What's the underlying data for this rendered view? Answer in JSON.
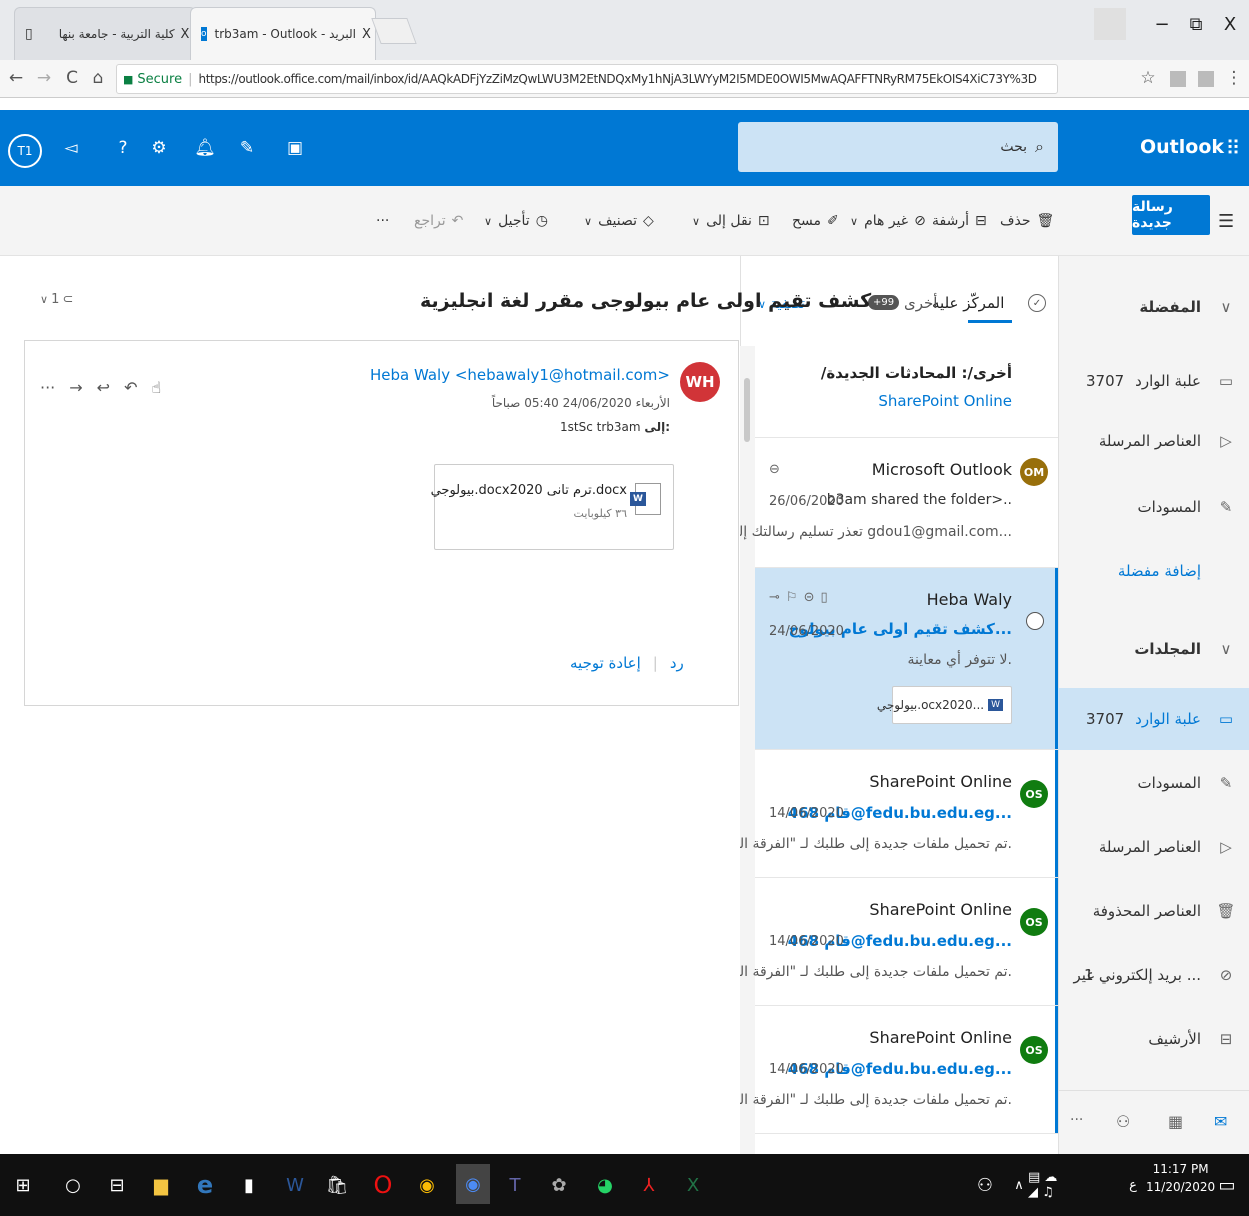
{
  "browser": {
    "tabs": [
      {
        "title": "كلية التربية - جامعة بنها"
      },
      {
        "title": "trb3am - Outlook - البريد"
      }
    ],
    "secure_label": "Secure",
    "url": "https://outlook.office.com/mail/inbox/id/AAQkADFjYzZiMzQwLWU3M2EtNDQxMy1hNjA3LWYyM2I5MDE0OWI5MwAQAFFTNRyRM75EkOIS4XiC73Y%3D"
  },
  "header": {
    "app_name": "Outlook",
    "avatar_initials": "T1",
    "search_placeholder": "بحث"
  },
  "toolbar": {
    "new_message": "رسالة جديدة",
    "delete": "حذف",
    "archive": "أرشفة",
    "junk": "غير هام",
    "sweep": "مسح",
    "move_to": "نقل إلى",
    "categorize": "تصنيف",
    "snooze": "تأجيل",
    "undo": "تراجع",
    "more": "···"
  },
  "nav": {
    "favorites_header": "المفضلة",
    "favorites": [
      {
        "label": "علبة الوارد",
        "count": "3707"
      },
      {
        "label": "العناصر المرسلة",
        "count": ""
      },
      {
        "label": "المسودات",
        "count": ""
      }
    ],
    "add_favorite": "إضافة مفضلة",
    "folders_header": "المجلدات",
    "folders": [
      {
        "label": "علبة الوارد",
        "count": "3707"
      },
      {
        "label": "المسودات",
        "count": ""
      },
      {
        "label": "العناصر المرسلة",
        "count": ""
      },
      {
        "label": "العناصر المحذوفة",
        "count": ""
      },
      {
        "label": "بريد إلكتروني غير ...",
        "count": "1"
      },
      {
        "label": "الأرشيف",
        "count": ""
      }
    ]
  },
  "list": {
    "focused_tab": "المركّز عليه",
    "other_tab": "أخرى",
    "other_badge": "+99",
    "filter": "تصفية",
    "banner_line1": "/أخرى/: المحادثات الجديدة",
    "banner_line2": "SharePoint Online",
    "messages": [
      {
        "initials": "OM",
        "sender": "Microsoft Outlook",
        "subject": "b3am shared the folder>..",
        "date": "26/06/2020",
        "preview": "تعذر تسليم رسالتك إلى gdou1@gmail.com...",
        "color": "#986f0b"
      },
      {
        "initials": "",
        "sender": "Heba Waly",
        "subject": "كشف تقيم اولى عام بيولوج...",
        "date": "24/06/2020",
        "preview": "لا تتوفر أي معاينة.",
        "attachment": "بيولوجي.ocx2020...",
        "color": "#0078d4"
      },
      {
        "initials": "OS",
        "sender": "SharePoint Online",
        "subject": "قام 468@fedu.bu.edu.eg...",
        "date": "14/06/2020",
        "preview": "تم تحميل ملفات جديدة إلى طلبك لـ \"الفرقة الـ.",
        "color": "#107c10"
      },
      {
        "initials": "OS",
        "sender": "SharePoint Online",
        "subject": "قام 468@fedu.bu.edu.eg...",
        "date": "14/06/2020",
        "preview": "تم تحميل ملفات جديدة إلى طلبك لـ \"الفرقة الـ.",
        "color": "#107c10"
      },
      {
        "initials": "OS",
        "sender": "SharePoint Online",
        "subject": "قام 468@fedu.bu.edu.eg...",
        "date": "14/06/2020",
        "preview": "تم تحميل ملفات جديدة إلى طلبك لـ \"الفرقة الـ.",
        "color": "#107c10"
      }
    ]
  },
  "reading": {
    "subject": "كشف تقيم اولى عام بيولوجى مقرر لغة انجليزية",
    "attach_count": "1",
    "from": "Heba Waly <hebawaly1@hotmail.com>",
    "date": "الأربعاء 24/06/2020 05:40 صباحاً",
    "to_label": "إلى:",
    "to": "1stSc trb3am",
    "avatar": "WH",
    "attachment_name": "بيولوجي.docx2020 ترم تانى.docx",
    "attachment_size": "٣٦ كيلوبايت",
    "reply": "رد",
    "forward": "إعادة توجيه"
  },
  "taskbar": {
    "time": "11:17 PM",
    "date": "11/20/2020",
    "lang": "ع"
  }
}
